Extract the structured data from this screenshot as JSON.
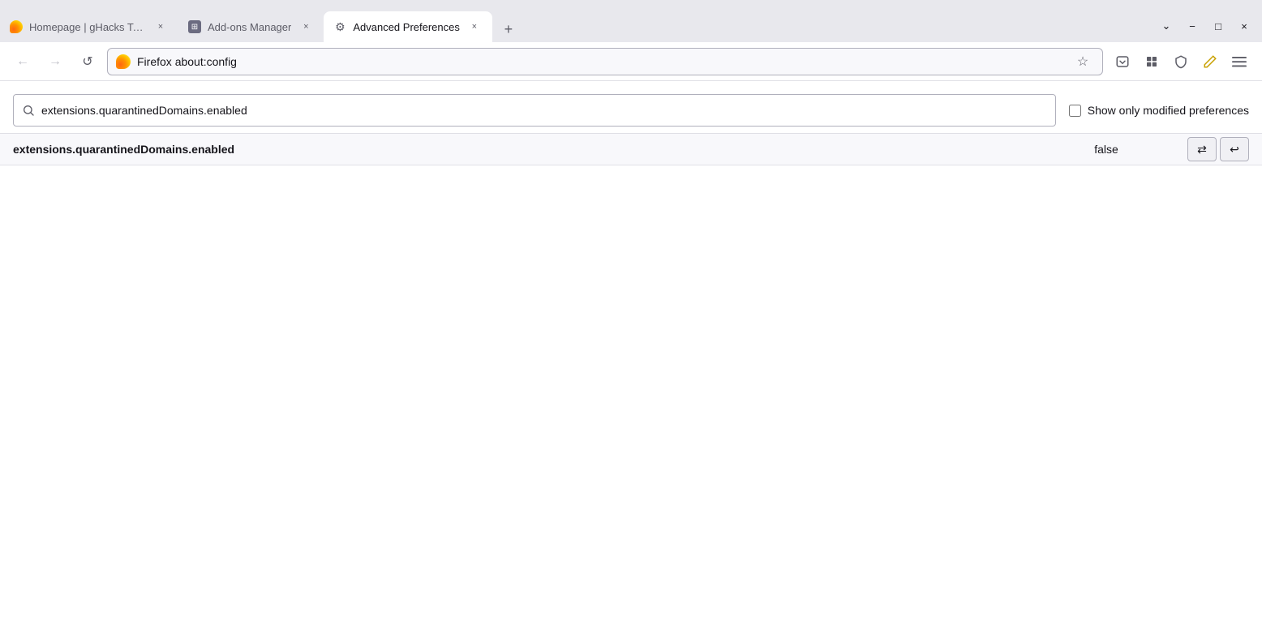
{
  "browser": {
    "tabs": [
      {
        "id": "tab-homepage",
        "label": "Homepage | gHacks Technolog...",
        "icon_type": "flame",
        "active": false,
        "close_label": "×"
      },
      {
        "id": "tab-addons",
        "label": "Add-ons Manager",
        "icon_type": "puzzle",
        "active": false,
        "close_label": "×"
      },
      {
        "id": "tab-advanced",
        "label": "Advanced Preferences",
        "icon_type": "gear",
        "active": true,
        "close_label": "×"
      }
    ],
    "new_tab_label": "+",
    "window_controls": {
      "minimize": "−",
      "maximize": "□",
      "close": "×",
      "list": "⌄"
    }
  },
  "navbar": {
    "back": "←",
    "forward": "→",
    "reload": "↺",
    "firefox_label": "Firefox",
    "address": "about:config",
    "star": "☆"
  },
  "toolbar": {
    "pocket": "📋",
    "extensions": "🧩",
    "shield": "🛡",
    "pen": "✏",
    "menu": "≡"
  },
  "search": {
    "placeholder": "extensions.quarantinedDomains.enabled",
    "current_value": "extensions.quarantinedDomains.enabled",
    "search_icon": "🔍",
    "modified_label": "Show only modified preferences",
    "modified_checked": false
  },
  "results": [
    {
      "name": "extensions.quarantinedDomains.enabled",
      "value": "false",
      "toggle_icon": "⇄",
      "reset_icon": "↩"
    }
  ]
}
